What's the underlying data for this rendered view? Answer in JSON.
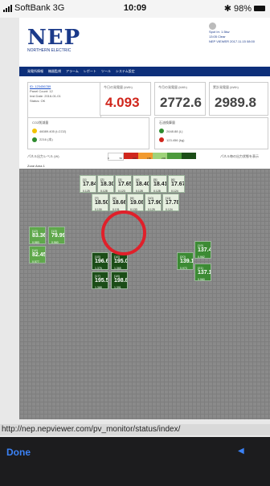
{
  "status_bar": {
    "carrier": "SoftBank",
    "network": "3G",
    "time": "10:09",
    "battery": "98%"
  },
  "header": {
    "logo": "NEP",
    "logo_sub": "NORTHERN ELECTRIC",
    "weather_lines": [
      "Spot Irr. 1.5kw",
      "13:05 Clear",
      "NEP VIEWER 2017.11.15 08:00"
    ]
  },
  "nav": {
    "items": [
      "発電所情報",
      "機器監視",
      "アラーム",
      "レポート",
      "ツール",
      "システム設定"
    ]
  },
  "info": {
    "lines": [
      "ID: 123456789",
      "Panel Count: 12",
      "Inst Date: 2016-01-01",
      "Status: OK"
    ]
  },
  "stats": [
    {
      "label": "今日の発電量 (kWh)",
      "value": "4.093"
    },
    {
      "label": "今月の発電量 (kWh)",
      "value": "2772.6"
    },
    {
      "label": "累計発電量 (kWh)",
      "value": "2989.8"
    }
  ],
  "env": [
    {
      "title": "CO2削減量",
      "lines": [
        "46089.405 (t-CO2)",
        "2216 (本)"
      ]
    },
    {
      "title": "石油換算量",
      "lines": [
        "2648.88 (L)",
        "123.456 (kg)"
      ]
    }
  ],
  "legend": {
    "label": "パネル出力レベル (W)",
    "ticks": [
      "0",
      "50",
      "100",
      "150",
      "200"
    ],
    "note": "パネル毎の出力状態を表示"
  },
  "area": {
    "title": "Zone Area 1"
  },
  "panels": [
    {
      "id": "[1]",
      "value": "17.84",
      "sub": "0.125",
      "tone": "pale"
    },
    {
      "id": "[2]",
      "value": "18.30",
      "sub": "0.128",
      "tone": "pale"
    },
    {
      "id": "[3]",
      "value": "17.65",
      "sub": "0.123",
      "tone": "pale"
    },
    {
      "id": "[4]",
      "value": "18.40",
      "sub": "0.128",
      "tone": "pale"
    },
    {
      "id": "[5]",
      "value": "18.41",
      "sub": "0.128",
      "tone": "pale"
    },
    {
      "id": "[6]",
      "value": "17.67",
      "sub": "0.124",
      "tone": "pale"
    },
    {
      "id": "[7]",
      "value": "18.50",
      "sub": "0.130",
      "tone": "pale"
    },
    {
      "id": "[8]",
      "value": "18.66",
      "sub": "0.131",
      "tone": "pale"
    },
    {
      "id": "[9]",
      "value": "19.08",
      "sub": "0.133",
      "tone": "pale"
    },
    {
      "id": "[10]",
      "value": "17.90",
      "sub": "0.125",
      "tone": "pale"
    },
    {
      "id": "[11]",
      "value": "17.78",
      "sub": "0.124",
      "tone": "pale"
    },
    {
      "id": "[12]",
      "value": "83.36",
      "sub": "0.583",
      "tone": "mid"
    },
    {
      "id": "[13]",
      "value": "79.99",
      "sub": "0.560",
      "tone": "mid"
    },
    {
      "id": "[14]",
      "value": "82.45",
      "sub": "0.577",
      "tone": "mid"
    },
    {
      "id": "[15]",
      "value": "196.66",
      "sub": "1.376",
      "tone": "dark"
    },
    {
      "id": "[16]",
      "value": "195.04",
      "sub": "1.365",
      "tone": "dark"
    },
    {
      "id": "[17]",
      "value": "195.54",
      "sub": "1.368",
      "tone": "dark"
    },
    {
      "id": "[18]",
      "value": "198.80",
      "sub": "1.391",
      "tone": "dark"
    },
    {
      "id": "[19]",
      "value": "137.48",
      "sub": "0.962",
      "tone": "greenmid"
    },
    {
      "id": "[20]",
      "value": "139.10",
      "sub": "0.973",
      "tone": "greenmid"
    },
    {
      "id": "[21]",
      "value": "137.17",
      "sub": "0.960",
      "tone": "greenmid"
    }
  ],
  "url": "http://nep.nepviewer.com/pv_monitor/status/index/",
  "bottom": {
    "done": "Done"
  },
  "colors": {
    "pale": "#e6efe0",
    "mid": "#5fa84b",
    "dark": "#1b4d17",
    "greenmid": "#3c8b34",
    "accent": "#d0261c",
    "nav": "#0d2f7a"
  }
}
